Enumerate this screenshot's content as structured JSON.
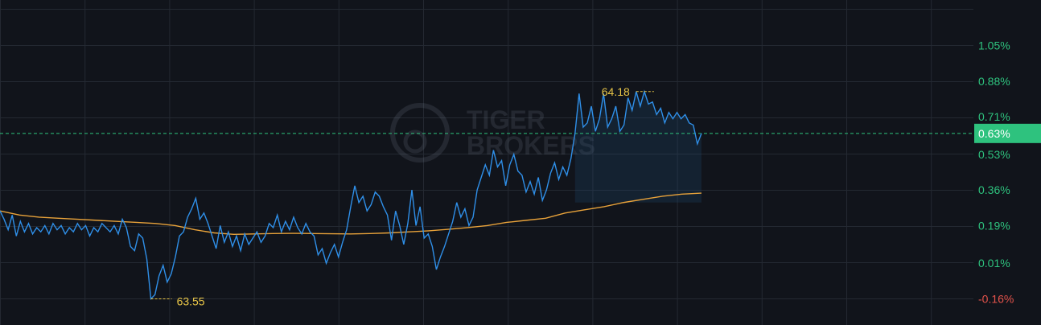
{
  "chart_data": {
    "type": "line",
    "title": "",
    "xlabel": "",
    "ylabel": "",
    "ylim": [
      -0.2,
      1.25
    ],
    "y_axis_position": "right",
    "grid": true,
    "y_ticks": [
      {
        "value": 1.05,
        "label": "1.05%"
      },
      {
        "value": 0.88,
        "label": "0.88%"
      },
      {
        "value": 0.71,
        "label": "0.71%"
      },
      {
        "value": 0.53,
        "label": "0.53%"
      },
      {
        "value": 0.36,
        "label": "0.36%"
      },
      {
        "value": 0.19,
        "label": "0.19%"
      },
      {
        "value": 0.01,
        "label": "0.01%"
      },
      {
        "value": -0.16,
        "label": "-0.16%"
      }
    ],
    "current": {
      "value": 0.63,
      "label": "0.63%"
    },
    "annotations": {
      "high": {
        "label": "64.18",
        "value": 0.83
      },
      "low": {
        "label": "63.55",
        "value": -0.16
      }
    },
    "series": [
      {
        "role": "price",
        "color": "#2f8fe8",
        "values": [
          0.26,
          0.22,
          0.17,
          0.24,
          0.14,
          0.21,
          0.16,
          0.2,
          0.15,
          0.18,
          0.16,
          0.19,
          0.15,
          0.2,
          0.17,
          0.19,
          0.15,
          0.18,
          0.16,
          0.2,
          0.17,
          0.19,
          0.14,
          0.18,
          0.16,
          0.2,
          0.18,
          0.16,
          0.19,
          0.15,
          0.22,
          0.18,
          0.09,
          0.07,
          0.15,
          0.13,
          0.03,
          -0.16,
          -0.14,
          -0.05,
          0.0,
          -0.08,
          -0.04,
          0.04,
          0.14,
          0.16,
          0.23,
          0.27,
          0.32,
          0.22,
          0.25,
          0.2,
          0.14,
          0.08,
          0.19,
          0.11,
          0.16,
          0.09,
          0.14,
          0.07,
          0.15,
          0.1,
          0.13,
          0.16,
          0.11,
          0.14,
          0.2,
          0.18,
          0.24,
          0.16,
          0.21,
          0.17,
          0.23,
          0.18,
          0.15,
          0.2,
          0.16,
          0.14,
          0.05,
          0.08,
          0.01,
          0.06,
          0.1,
          0.04,
          0.11,
          0.17,
          0.28,
          0.38,
          0.3,
          0.33,
          0.26,
          0.29,
          0.35,
          0.33,
          0.28,
          0.24,
          0.12,
          0.26,
          0.19,
          0.1,
          0.2,
          0.36,
          0.19,
          0.28,
          0.13,
          0.15,
          0.09,
          -0.02,
          0.04,
          0.09,
          0.15,
          0.21,
          0.3,
          0.23,
          0.27,
          0.19,
          0.23,
          0.36,
          0.42,
          0.48,
          0.43,
          0.55,
          0.47,
          0.5,
          0.38,
          0.48,
          0.53,
          0.45,
          0.43,
          0.35,
          0.4,
          0.34,
          0.42,
          0.31,
          0.36,
          0.44,
          0.49,
          0.41,
          0.47,
          0.43,
          0.51,
          0.63,
          0.82,
          0.66,
          0.68,
          0.76,
          0.64,
          0.7,
          0.82,
          0.66,
          0.7,
          0.76,
          0.64,
          0.67,
          0.8,
          0.74,
          0.83,
          0.76,
          0.83,
          0.77,
          0.78,
          0.72,
          0.75,
          0.68,
          0.73,
          0.7,
          0.73,
          0.7,
          0.72,
          0.68,
          0.67,
          0.58,
          0.63
        ],
        "x_fraction_of_span": 0.7206
      },
      {
        "role": "average",
        "color": "#e8a23a",
        "values": [
          0.26,
          0.24,
          0.23,
          0.225,
          0.22,
          0.215,
          0.21,
          0.205,
          0.2,
          0.19,
          0.17,
          0.155,
          0.148,
          0.15,
          0.152,
          0.153,
          0.152,
          0.151,
          0.15,
          0.152,
          0.155,
          0.16,
          0.165,
          0.172,
          0.18,
          0.19,
          0.205,
          0.215,
          0.225,
          0.25,
          0.265,
          0.28,
          0.3,
          0.315,
          0.33,
          0.34,
          0.345
        ],
        "x_fraction_of_span": 0.7206
      }
    ]
  },
  "watermark": {
    "line1": "TIGER",
    "line2": "BROKERS"
  },
  "colors": {
    "background": "#11141b",
    "grid": "#242932",
    "positive": "#2ec27e",
    "negative": "#e5534b",
    "annotation": "#e8c547",
    "current_badge": "#2ec27e"
  }
}
